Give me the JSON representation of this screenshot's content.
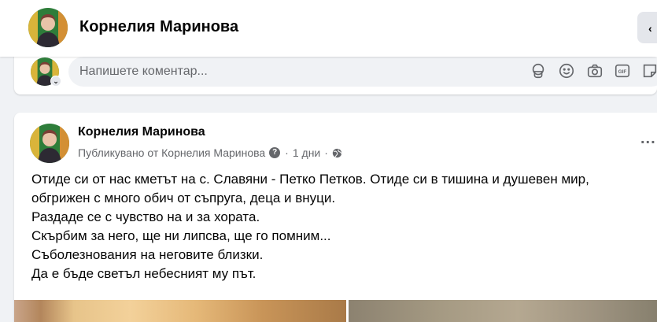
{
  "header": {
    "page_name": "Корнелия Маринова",
    "more_icon": "chevron-icon"
  },
  "comment_box": {
    "placeholder": "Напишете коментар...",
    "icons": [
      "avatar-sticker-icon",
      "emoji-icon",
      "camera-icon",
      "gif-icon",
      "sticker-icon"
    ]
  },
  "post": {
    "author": "Корнелия Маринова",
    "published_by": "Публикувано от Корнелия Маринова",
    "time": "1 дни",
    "separator": "·",
    "privacy_icon": "globe-icon",
    "more_label": "...",
    "lines": [
      "Отиде си от нас кметът на с. Славяни - Петко Петков. Отиде си в тишина и душевен мир,",
      "обгрижен с много обич от съпруга, деца и внуци.",
      "Раздаде се с чувство на и за хората.",
      "Скърбим за него, ще ни липсва, ще го помним...",
      "Съболезнования на неговите близки.",
      "Да е бъде светъл небесният му път."
    ]
  },
  "colors": {
    "background": "#f0f2f5",
    "card": "#ffffff",
    "secondary_text": "#65676b"
  }
}
